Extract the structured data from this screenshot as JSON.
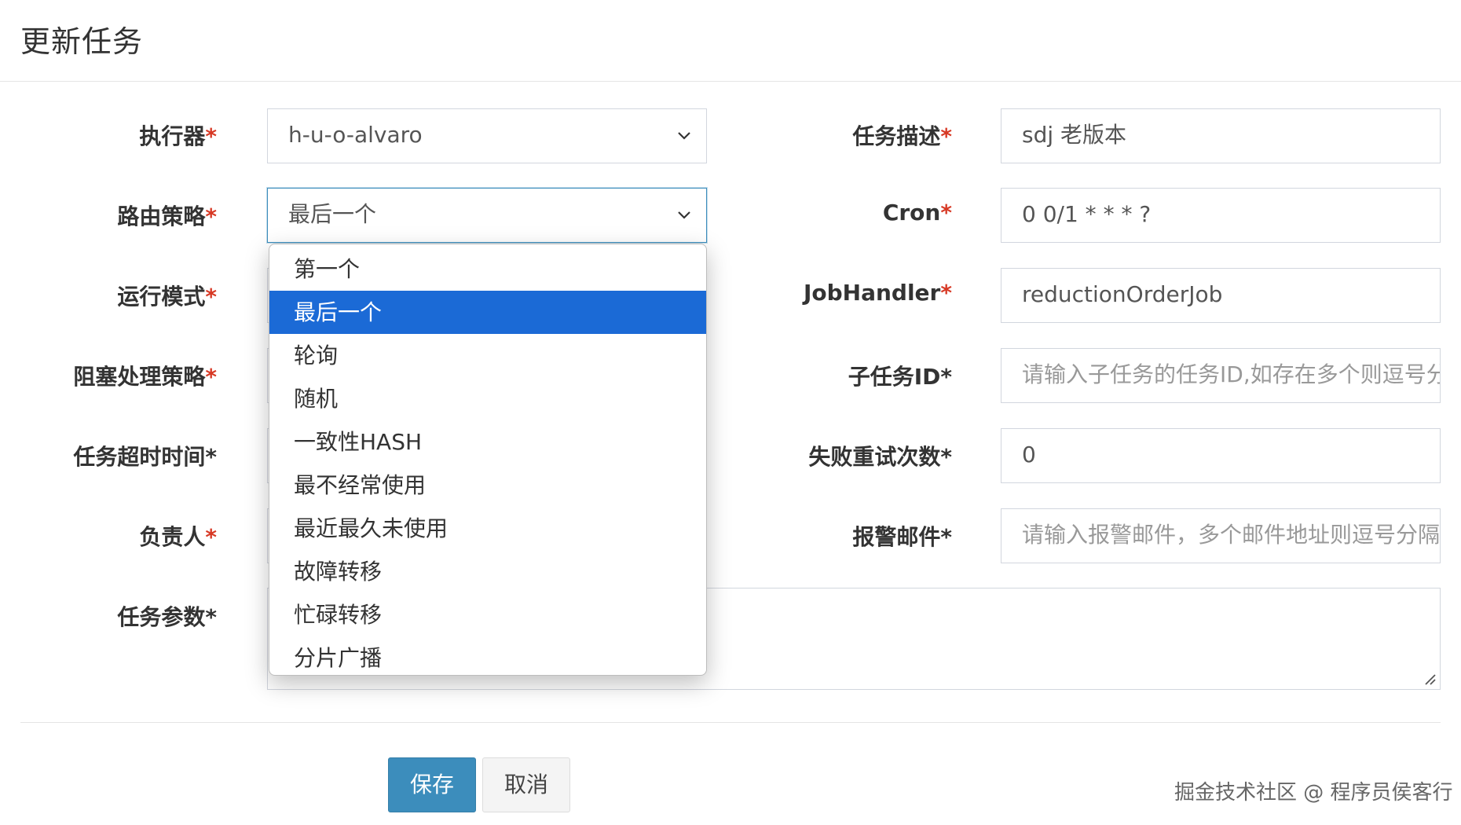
{
  "title": "更新任务",
  "left_fields": [
    {
      "label": "执行器",
      "required_mark": "*",
      "value": "h-u-o-alvaro",
      "type": "select"
    },
    {
      "label": "路由策略",
      "required_mark": "*",
      "value": "最后一个",
      "type": "select"
    },
    {
      "label": "运行模式",
      "required_mark": "*"
    },
    {
      "label": "阻塞处理策略",
      "required_mark": "*"
    },
    {
      "label": "任务超时时间*"
    },
    {
      "label": "负责人",
      "required_mark": "*"
    },
    {
      "label": "任务参数*"
    }
  ],
  "right_fields": [
    {
      "label": "任务描述",
      "required_mark": "*",
      "value": "sdj 老版本"
    },
    {
      "label": "Cron",
      "required_mark": "*",
      "value": "0 0/1 * * * ?"
    },
    {
      "label": "JobHandler",
      "required_mark": "*",
      "value": "reductionOrderJob"
    },
    {
      "label": "子任务ID*",
      "placeholder": "请输入子任务的任务ID,如存在多个则逗号分隔"
    },
    {
      "label": "失败重试次数*",
      "value": "0"
    },
    {
      "label": "报警邮件*",
      "placeholder": "请输入报警邮件，多个邮件地址则逗号分隔"
    }
  ],
  "routing_dropdown": {
    "options": [
      "第一个",
      "最后一个",
      "轮询",
      "随机",
      "一致性HASH",
      "最不经常使用",
      "最近最久未使用",
      "故障转移",
      "忙碌转移",
      "分片广播"
    ],
    "selected": "最后一个"
  },
  "buttons": {
    "save": "保存",
    "cancel": "取消"
  },
  "watermark": "掘金技术社区 @ 程序员侯客行",
  "colors": {
    "primary": "#3c8dbc",
    "selected_option": "#1b6ad6",
    "required": "#d73925"
  }
}
